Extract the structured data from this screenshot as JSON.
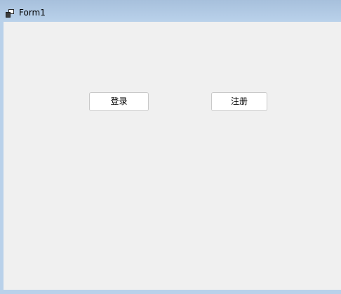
{
  "window": {
    "title": "Form1",
    "icon": "winforms-app-icon"
  },
  "buttons": {
    "login_label": "登录",
    "register_label": "注册"
  },
  "colors": {
    "client_background": "#f0f0f0",
    "frame": "#b9d1ea",
    "button_background": "#ffffff",
    "button_border": "#c9c9c9"
  }
}
